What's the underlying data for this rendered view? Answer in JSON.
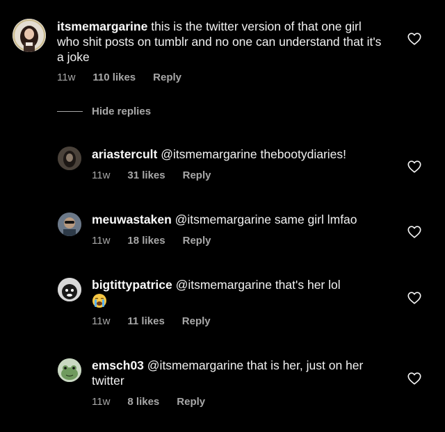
{
  "comments": [
    {
      "username": "itsmemargarine",
      "text": " this is the twitter version of that one girl who shit posts on tumblr and no one can understand that it's a joke",
      "time": "11w",
      "likes": "110 likes",
      "reply": "Reply",
      "avatar": "woman-with-dark-hair-avatar"
    },
    {
      "username": "ariastercult",
      "mention": "@itsmemargarine",
      "text": " thebootydiaries!",
      "time": "11w",
      "likes": "31 likes",
      "reply": "Reply",
      "avatar": "dark-portrait-avatar"
    },
    {
      "username": "meuwastaken",
      "mention": "@itsmemargarine",
      "text": " same girl lmfao",
      "time": "11w",
      "likes": "18 likes",
      "reply": "Reply",
      "avatar": "person-with-sunglasses-avatar"
    },
    {
      "username": "bigtittypatrice",
      "mention": "@itsmemargarine",
      "text": " that's her lol",
      "emoji": "loudly-crying-face-emoji",
      "time": "11w",
      "likes": "11 likes",
      "reply": "Reply",
      "avatar": "cartoon-face-avatar"
    },
    {
      "username": "emsch03",
      "mention": "@itsmemargarine",
      "text": " that is her, just on her twitter",
      "time": "11w",
      "likes": "8 likes",
      "reply": "Reply",
      "avatar": "frog-avatar"
    }
  ],
  "hide_replies": "Hide replies",
  "colors": {
    "background": "#000000",
    "text": "#f5f5f5",
    "secondary": "#a8a8a8"
  }
}
